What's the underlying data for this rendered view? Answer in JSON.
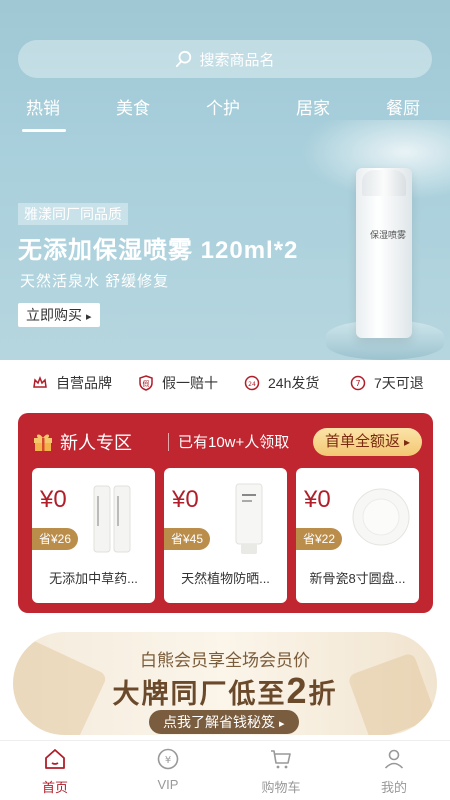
{
  "search": {
    "placeholder": "搜索商品名"
  },
  "tabs": [
    "热销",
    "美食",
    "个护",
    "居家",
    "餐厨"
  ],
  "hero": {
    "tag": "雅漾同厂同品质",
    "title": "无添加保湿喷雾 120ml*2",
    "subtitle": "天然活泉水  舒缓修复",
    "button": "立即购买",
    "bottle_label": "保湿喷雾"
  },
  "services": [
    {
      "icon": "crown-icon",
      "label": "自营品牌"
    },
    {
      "icon": "shield-icon",
      "label": "假一赔十"
    },
    {
      "icon": "clock-icon",
      "label": "24h发货"
    },
    {
      "icon": "return-icon",
      "label": "7天可退"
    }
  ],
  "new_user": {
    "title": "新人专区",
    "subtitle": "已有10w+人领取",
    "button": "首单全额返",
    "items": [
      {
        "price": "¥0",
        "save": "省¥26",
        "name": "无添加中草药..."
      },
      {
        "price": "¥0",
        "save": "省¥45",
        "name": "天然植物防晒..."
      },
      {
        "price": "¥0",
        "save": "省¥22",
        "name": "新骨瓷8寸圆盘..."
      }
    ]
  },
  "member": {
    "line1": "白熊会员享全场会员价",
    "line2_prefix": "大牌同厂低至",
    "line2_number": "2",
    "line2_suffix": "折",
    "button": "点我了解省钱秘笈"
  },
  "bottom_nav": [
    {
      "label": "首页",
      "active": true
    },
    {
      "label": "VIP",
      "active": false
    },
    {
      "label": "购物车",
      "active": false
    },
    {
      "label": "我的",
      "active": false
    }
  ],
  "colors": {
    "brand_red": "#bf2630",
    "hero_blue": "#a9d0dc",
    "gold": "#bb8d4a"
  }
}
